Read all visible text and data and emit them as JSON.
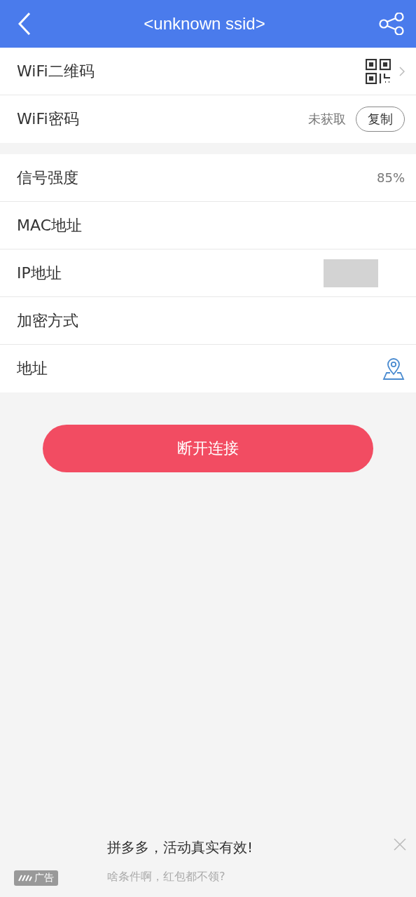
{
  "header": {
    "title": "<unknown ssid>"
  },
  "sections": [
    {
      "rows": [
        {
          "label": "WiFi二维码",
          "kind": "qr"
        },
        {
          "label": "WiFi密码",
          "kind": "password",
          "value": "未获取",
          "button": "复制"
        }
      ]
    },
    {
      "rows": [
        {
          "label": "信号强度",
          "kind": "value",
          "value": "85%"
        },
        {
          "label": "MAC地址",
          "kind": "plain"
        },
        {
          "label": "IP地址",
          "kind": "redacted"
        },
        {
          "label": "加密方式",
          "kind": "plain"
        },
        {
          "label": "地址",
          "kind": "location"
        }
      ]
    }
  ],
  "disconnect_button": "断开连接",
  "ad": {
    "badge": "广告",
    "title": "拼多多，活动真实有效!",
    "subtitle": "啥条件啊，红包都不领?"
  }
}
